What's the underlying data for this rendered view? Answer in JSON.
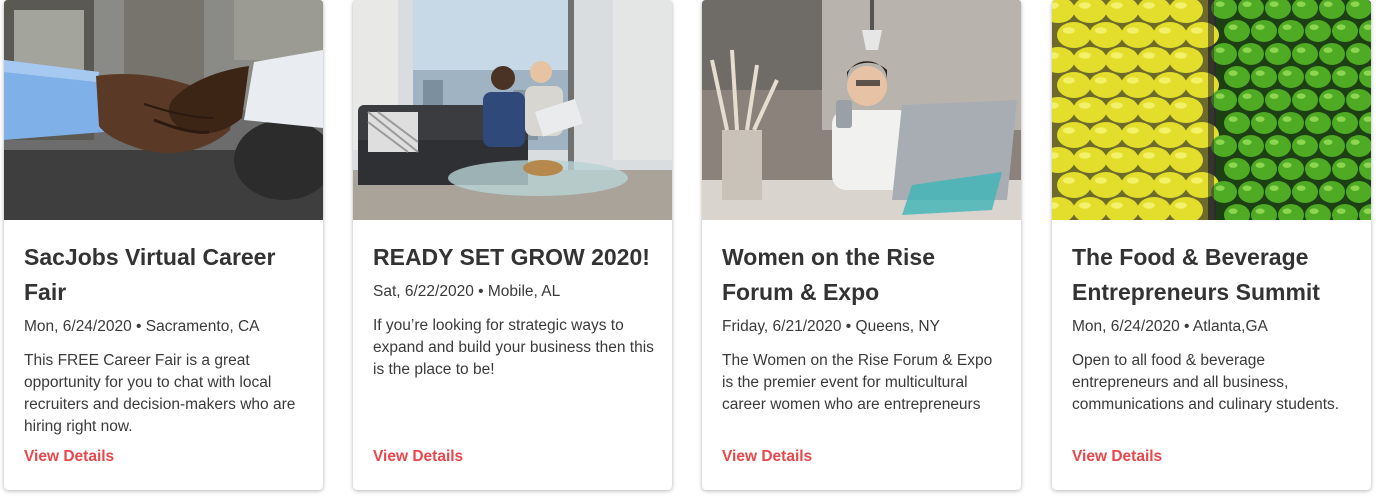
{
  "colors": {
    "accent": "#e8474c",
    "title": "#333333",
    "text": "#3a3a3a"
  },
  "events": [
    {
      "image": "handshake-photo",
      "title": "SacJobs Virtual Career Fair",
      "meta": "Mon, 6/24/2020 • Sacramento, CA",
      "description": "This FREE Career Fair is a great opportunity for you to chat with local recruiters and decision-makers who are hiring right now.",
      "link_label": "View Details"
    },
    {
      "image": "office-meeting-photo",
      "title": "READY SET GROW 2020!",
      "meta": "Sat, 6/22/2020 • Mobile, AL",
      "description": "If you’re looking for strategic ways to expand and build your business then this is the place to be!",
      "link_label": "View Details"
    },
    {
      "image": "woman-with-phone-photo",
      "title": "Women on the Rise Forum & Expo",
      "meta": "Friday, 6/21/2020 • Queens, NY",
      "description": "The Women on the Rise Forum & Expo is the premier event for multicultural career women who are entrepreneurs",
      "link_label": "View Details"
    },
    {
      "image": "lemons-and-limes-photo",
      "title": "The Food & Beverage Entrepreneurs Summit",
      "meta": "Mon, 6/24/2020 • Atlanta,GA",
      "description": "Open to all food & beverage entrepreneurs and all business, communications and culinary students.",
      "link_label": "View Details"
    }
  ]
}
